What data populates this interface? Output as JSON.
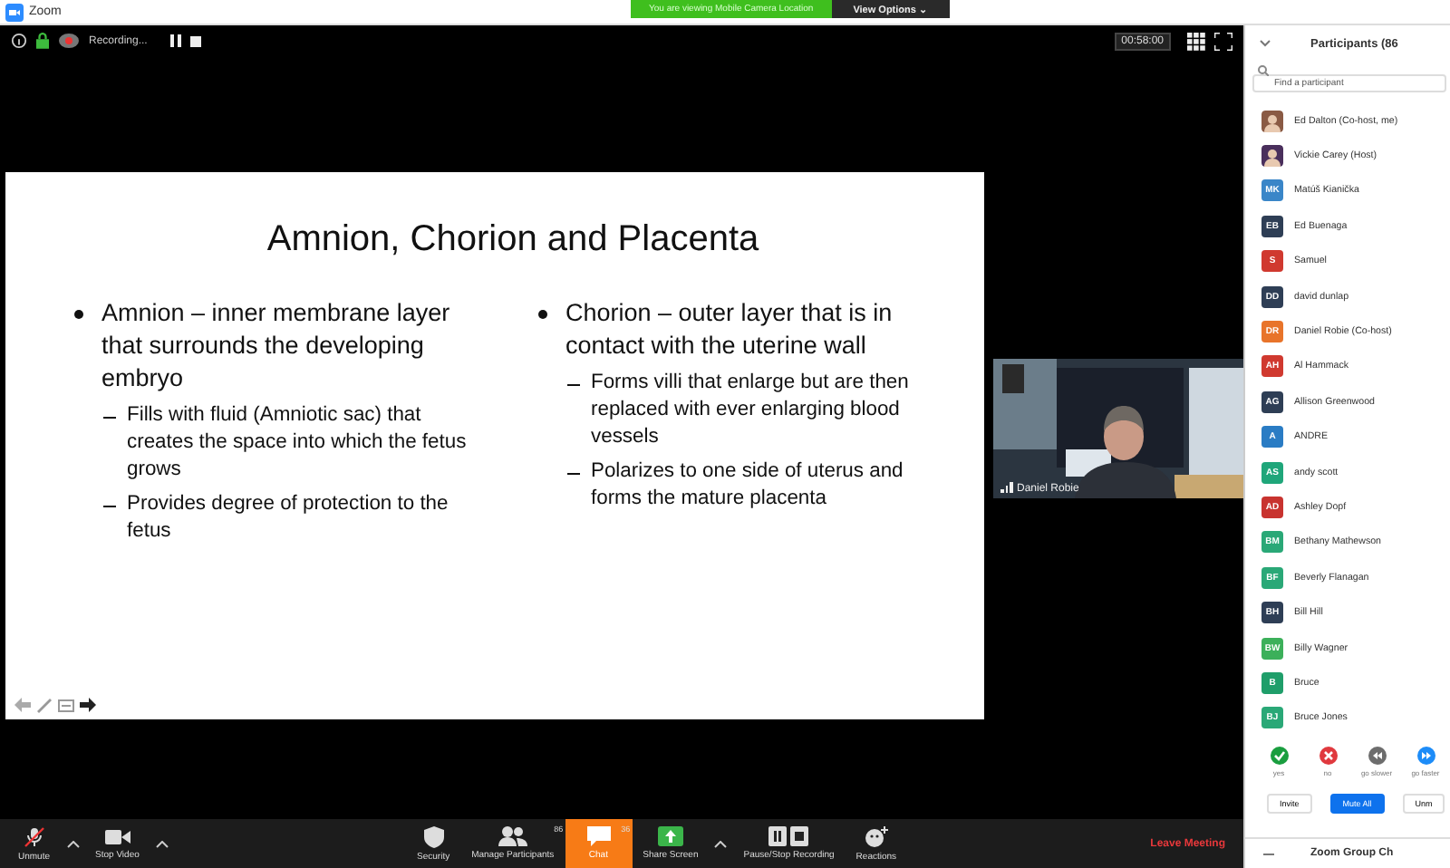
{
  "window": {
    "title": "Zoom"
  },
  "banner": {
    "text": "You are viewing Mobile Camera Location",
    "button": "View Options ⌄"
  },
  "meeting_bar": {
    "recording": "Recording...",
    "timer": "00:58:00"
  },
  "slide": {
    "title": "Amnion, Chorion and Placenta",
    "columns": [
      {
        "bullet": "Amnion – inner membrane layer that surrounds the developing embryo",
        "subs": [
          "Fills with fluid (Amniotic sac) that creates the space into which the fetus grows",
          "Provides degree of protection to the fetus"
        ]
      },
      {
        "bullet": "Chorion – outer layer that is in contact with the uterine wall",
        "subs": [
          "Forms villi that enlarge but are then replaced with ever enlarging blood vessels",
          "Polarizes to one side of uterus and forms the mature placenta"
        ]
      }
    ]
  },
  "video": {
    "name": "Daniel Robie"
  },
  "toolbar": {
    "unmute": "Unmute",
    "stop_video": "Stop Video",
    "security": "Security",
    "manage_participants": {
      "label": "Manage Participants",
      "badge": "86"
    },
    "chat": {
      "label": "Chat",
      "badge": "36",
      "active": true
    },
    "share_screen": "Share Screen",
    "recording": "Pause/Stop Recording",
    "reactions": "Reactions",
    "leave": "Leave Meeting"
  },
  "participants": {
    "title": "Participants (86",
    "search": {
      "placeholder": "Find a participant"
    },
    "items": [
      {
        "name": "Ed Dalton (Co-host, me)",
        "color": "#8a5a44"
      },
      {
        "name": "Vickie Carey (Host)",
        "color": "#4a2f5c"
      },
      {
        "kind": "initials",
        "initials": "MK",
        "name": "Matúš Kianička",
        "color": "#3a86c8"
      },
      {
        "kind": "initials",
        "initials": "EB",
        "name": "Ed Buenaga",
        "color": "#2e3e55"
      },
      {
        "kind": "initials",
        "initials": "S",
        "name": "Samuel",
        "color": "#d0392f"
      },
      {
        "kind": "initials",
        "initials": "DD",
        "name": "david dunlap",
        "color": "#2e3e55"
      },
      {
        "kind": "initials",
        "initials": "DR",
        "name": "Daniel Robie (Co-host)",
        "color": "#e8742a"
      },
      {
        "kind": "initials",
        "initials": "AH",
        "name": "Al Hammack",
        "color": "#d0392f"
      },
      {
        "kind": "initials",
        "initials": "AG",
        "name": "Allison Greenwood",
        "color": "#2e3e55"
      },
      {
        "kind": "initials",
        "initials": "A",
        "name": "ANDRE",
        "color": "#2a7cc4"
      },
      {
        "kind": "initials",
        "initials": "AS",
        "name": "andy scott",
        "color": "#1fa67a"
      },
      {
        "kind": "initials",
        "initials": "AD",
        "name": "Ashley Dopf",
        "color": "#c8332f"
      },
      {
        "kind": "initials",
        "initials": "BM",
        "name": "Bethany Mathewson",
        "color": "#2aa877"
      },
      {
        "kind": "initials",
        "initials": "BF",
        "name": "Beverly Flanagan",
        "color": "#2aa877"
      },
      {
        "kind": "initials",
        "initials": "BH",
        "name": "Bill Hill",
        "color": "#2e3e55"
      },
      {
        "kind": "initials",
        "initials": "BW",
        "name": "Billy Wagner",
        "color": "#3cb05a"
      },
      {
        "kind": "initials",
        "initials": "B",
        "name": "Bruce",
        "color": "#1f9e6a"
      },
      {
        "kind": "initials",
        "initials": "BJ",
        "name": "Bruce Jones",
        "color": "#2aa877"
      }
    ],
    "reactions": [
      {
        "label": "yes",
        "color": "#1a9e3f"
      },
      {
        "label": "no",
        "color": "#e0393e"
      },
      {
        "label": "go slower",
        "color": "#6d6d6d"
      },
      {
        "label": "go faster",
        "color": "#1d8cf8"
      }
    ],
    "buttons": [
      {
        "label": "Invite",
        "primary": false
      },
      {
        "label": "Mute All",
        "primary": true
      },
      {
        "label": "Unm",
        "primary": false
      }
    ],
    "chat_header": "Zoom Group Ch"
  }
}
